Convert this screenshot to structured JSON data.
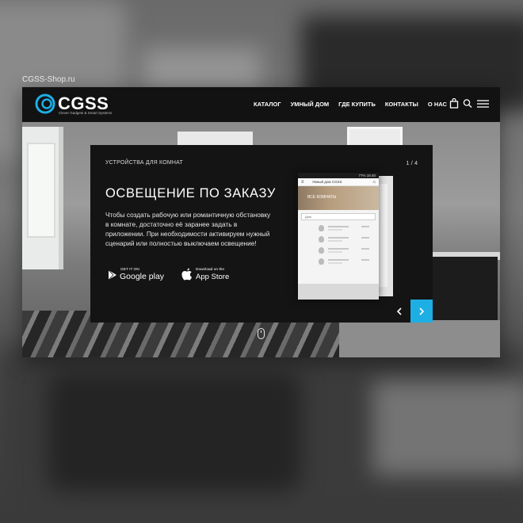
{
  "site": {
    "url": "CGSS-Shop.ru"
  },
  "logo": {
    "name": "CGSS",
    "tagline": "Clever Gadgets & Smart Systems"
  },
  "nav": {
    "items": [
      "КАТАЛОГ",
      "УМНЫЙ ДОМ",
      "ГДЕ КУПИТЬ",
      "КОНТАКТЫ",
      "О НАС"
    ],
    "icons": [
      "bag-icon",
      "search-icon",
      "menu-icon"
    ]
  },
  "slide": {
    "category": "УСТРОЙСТВА ДЛЯ КОМНАТ",
    "counter": "1 / 4",
    "title": "ОСВЕЩЕНИЕ ПО ЗАКАЗУ",
    "description": "Чтобы создать рабочую или романтичную обстановку в комнате, достаточно её заранее задать в приложении. При необходимости активируем нужный сценарий или полностью выключаем освещение!"
  },
  "stores": {
    "google": {
      "small": "GET IT ON",
      "big": "Google play"
    },
    "apple": {
      "small": "Download on the",
      "big": "App Store"
    }
  },
  "phone": {
    "status": "77% 16:40",
    "app_title": "Умный дом CGSS",
    "banner": "ВСЕ КОМНАТЫ",
    "select": "Дом"
  },
  "colors": {
    "accent": "#1daee4",
    "header": "#121212",
    "panel": "#141414"
  }
}
